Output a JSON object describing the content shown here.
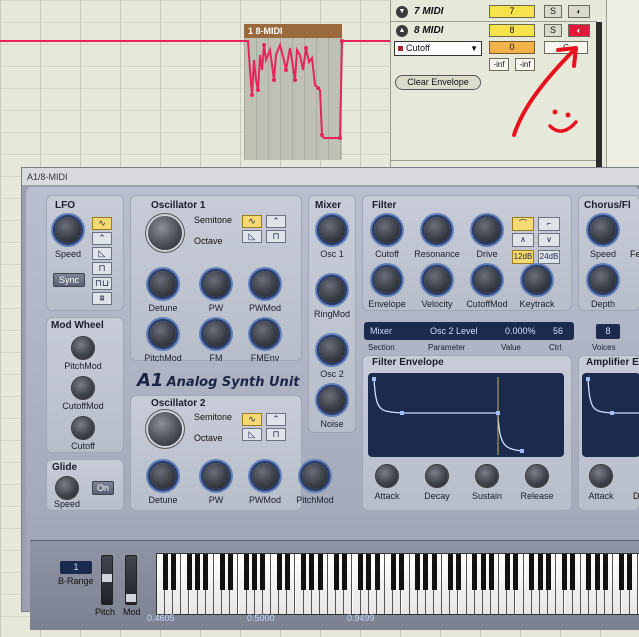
{
  "clip": {
    "title": "1 8-MIDI"
  },
  "tracks": {
    "track7": {
      "name": "7 MIDI",
      "value": "7",
      "solo": "S"
    },
    "track8": {
      "name": "8 MIDI",
      "value": "8",
      "solo": "S",
      "param": "Cutoff",
      "level": "0",
      "pan": "C",
      "inf_left": "-inf",
      "inf_right": "-inf",
      "clear_label": "Clear Envelope"
    }
  },
  "plugin": {
    "window_title": "A1/8-MIDI",
    "brand_a1": "A1",
    "brand_rest": "Analog Synth Unit",
    "lfo": {
      "title": "LFO",
      "speed": "Speed",
      "sync": "Sync"
    },
    "osc1": {
      "title": "Oscillator 1",
      "semitone": "Semitone",
      "octave": "Octave",
      "detune": "Detune",
      "pw": "PW",
      "pwmod": "PWMod",
      "pitchmod": "PitchMod",
      "fm": "FM",
      "fmenv": "FMEnv"
    },
    "osc2": {
      "title": "Oscillator 2",
      "semitone": "Semitone",
      "octave": "Octave",
      "detune": "Detune",
      "pw": "PW",
      "pwmod": "PWMod",
      "pitchmod": "PitchMod"
    },
    "mixer": {
      "title": "Mixer",
      "osc1": "Osc 1",
      "ringmod": "RingMod",
      "osc2": "Osc 2",
      "noise": "Noise"
    },
    "filter": {
      "title": "Filter",
      "cutoff": "Cutoff",
      "resonance": "Resonance",
      "drive": "Drive",
      "envelope": "Envelope",
      "velocity": "Velocity",
      "cutoffmod": "CutoffMod",
      "keytrack": "Keytrack",
      "slope12": "12dB",
      "slope24": "24dB"
    },
    "chorus": {
      "title": "Chorus/Fl",
      "speed": "Speed",
      "depth": "Depth",
      "fe": "Fe"
    },
    "modwheel": {
      "title": "Mod Wheel",
      "pitchmod": "PitchMod",
      "cutoffmod": "CutoffMod",
      "cutoff": "Cutoff"
    },
    "glide": {
      "title": "Glide",
      "speed": "Speed",
      "on": "On"
    },
    "lcd": {
      "section": "Mixer",
      "parameter": "Osc 2 Level",
      "value": "0.000%",
      "ctrl": "56",
      "cap_section": "Section",
      "cap_parameter": "Parameter",
      "cap_value": "Value",
      "cap_ctrl": "Ctrl."
    },
    "voices": {
      "value": "8",
      "label": "Voices"
    },
    "filter_env": {
      "title": "Filter Envelope",
      "attack": "Attack",
      "decay": "Decay",
      "sustain": "Sustain",
      "release": "Release"
    },
    "amp_env": {
      "title": "Amplifier E",
      "attack": "Attack",
      "decay": "D"
    },
    "keyboard_area": {
      "brange_value": "1",
      "brange_label": "B-Range",
      "pitch": "Pitch",
      "mod": "Mod",
      "readout1": "0.4605",
      "readout2": "0.5000",
      "readout3": "0.9499"
    }
  },
  "colors": {
    "envelope_line": "#e8245a",
    "annotation": "#e8121e",
    "lcd_bg": "#1c2a4e",
    "active_button": "#f5d972"
  }
}
